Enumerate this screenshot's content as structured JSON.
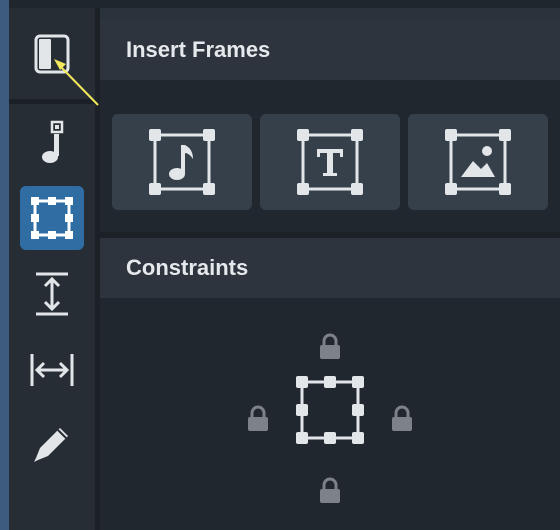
{
  "panels": {
    "insert_frames": {
      "title": "Insert Frames"
    },
    "constraints": {
      "title": "Constraints"
    }
  },
  "toolbar": {
    "items": [
      {
        "icon": "panel-toggle-icon"
      },
      {
        "icon": "note-input-icon"
      },
      {
        "icon": "frame-select-icon",
        "active": true
      },
      {
        "icon": "vertical-spacing-icon"
      },
      {
        "icon": "horizontal-spacing-icon"
      },
      {
        "icon": "pen-icon"
      }
    ]
  },
  "frames": [
    {
      "icon": "music-frame-icon"
    },
    {
      "icon": "text-frame-icon"
    },
    {
      "icon": "image-frame-icon"
    }
  ],
  "colors": {
    "accent": "#2f6da3",
    "annotation_arrow": "#f2e85c"
  }
}
